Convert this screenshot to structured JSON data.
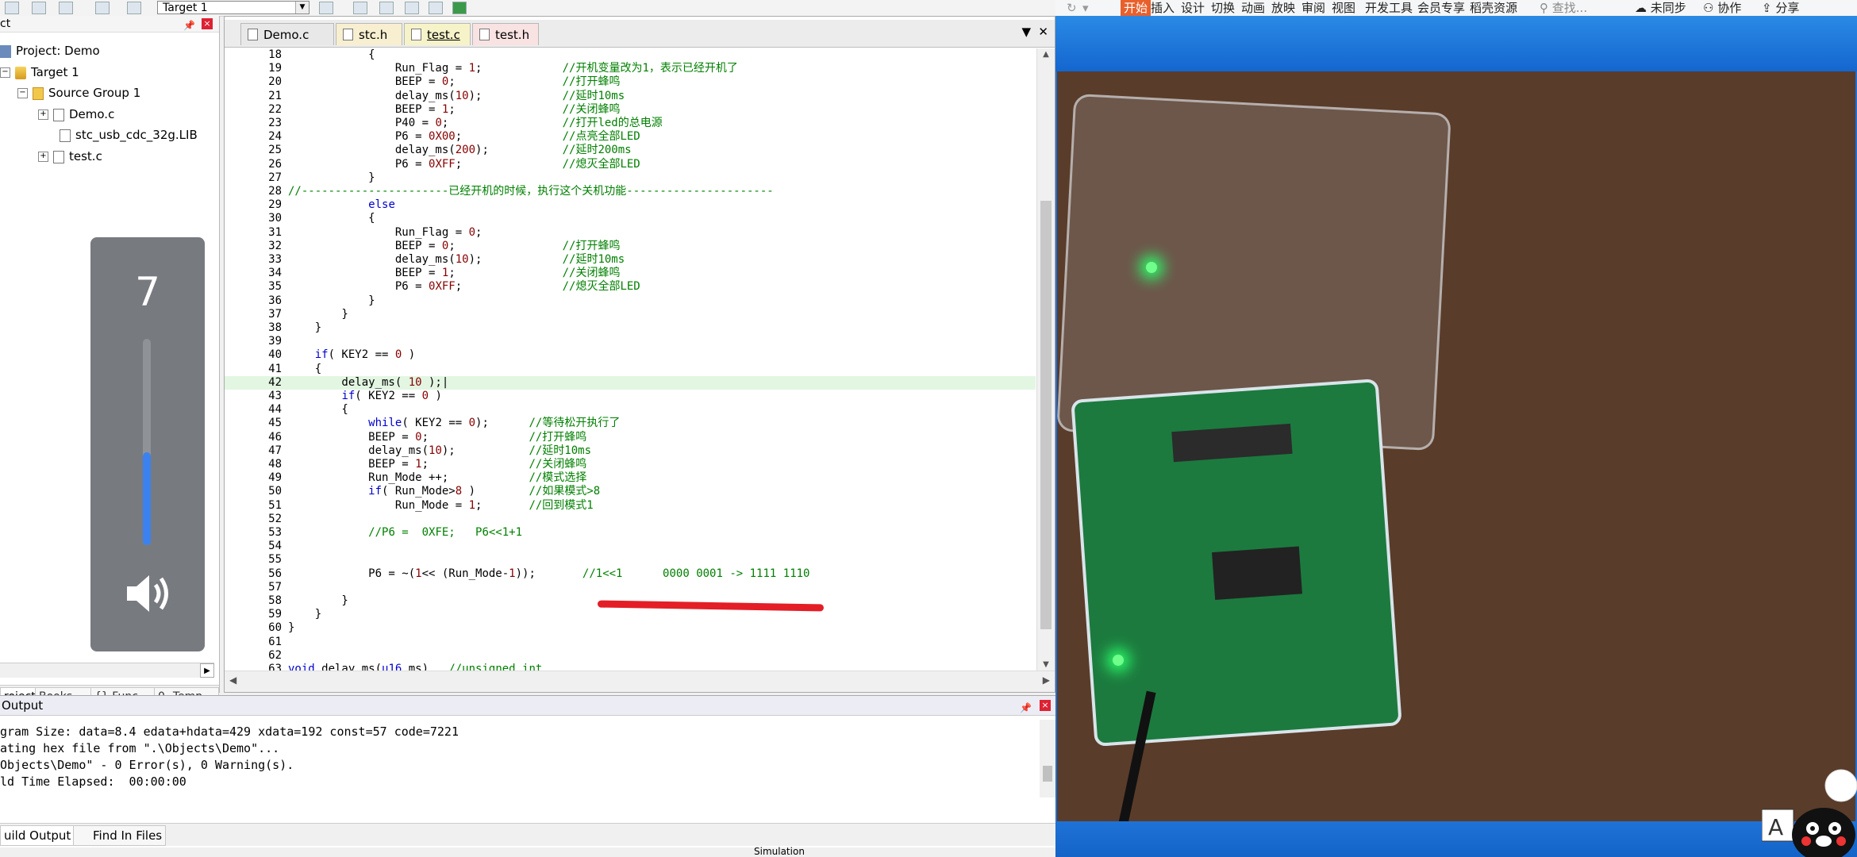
{
  "toolbar": {
    "target_select": "Target 1"
  },
  "project_panel": {
    "header": "ct",
    "tree": [
      {
        "label": "Project: Demo"
      },
      {
        "label": "Target 1"
      },
      {
        "label": "Source Group 1"
      },
      {
        "label": "Demo.c"
      },
      {
        "label": "stc_usb_cdc_32g.LIB"
      },
      {
        "label": "test.c"
      }
    ],
    "tabs": [
      "roject",
      "Books",
      "{} Func...",
      "0ₐ Temp..."
    ]
  },
  "volume_overlay": {
    "value": "7",
    "level": 0.45
  },
  "editor": {
    "tabs": [
      "Demo.c",
      "stc.h",
      "test.c",
      "test.h"
    ],
    "active_tab": "test.c",
    "highlighted_line": "42",
    "lines": [
      {
        "n": "18",
        "t": "            {"
      },
      {
        "n": "19",
        "t": "                Run_Flag = 1;            //开机变量改为1，表示已经开机了"
      },
      {
        "n": "20",
        "t": "                BEEP = 0;                //打开蜂鸣"
      },
      {
        "n": "21",
        "t": "                delay_ms(10);            //延时10ms"
      },
      {
        "n": "22",
        "t": "                BEEP = 1;                //关闭蜂鸣"
      },
      {
        "n": "23",
        "t": "                P40 = 0;                 //打开led的总电源"
      },
      {
        "n": "24",
        "t": "                P6 = 0X00;               //点亮全部LED"
      },
      {
        "n": "25",
        "t": "                delay_ms(200);           //延时200ms"
      },
      {
        "n": "26",
        "t": "                P6 = 0XFF;               //熄灭全部LED"
      },
      {
        "n": "27",
        "t": "            }"
      },
      {
        "n": "28",
        "t": "//----------------------已经开机的时候，执行这个关机功能----------------------"
      },
      {
        "n": "29",
        "t": "            else"
      },
      {
        "n": "30",
        "t": "            {"
      },
      {
        "n": "31",
        "t": "                Run_Flag = 0;"
      },
      {
        "n": "32",
        "t": "                BEEP = 0;                //打开蜂鸣"
      },
      {
        "n": "33",
        "t": "                delay_ms(10);            //延时10ms"
      },
      {
        "n": "34",
        "t": "                BEEP = 1;                //关闭蜂鸣"
      },
      {
        "n": "35",
        "t": "                P6 = 0XFF;               //熄灭全部LED"
      },
      {
        "n": "36",
        "t": "            }"
      },
      {
        "n": "37",
        "t": "        }"
      },
      {
        "n": "38",
        "t": "    }"
      },
      {
        "n": "39",
        "t": ""
      },
      {
        "n": "40",
        "t": "    if( KEY2 == 0 )"
      },
      {
        "n": "41",
        "t": "    {"
      },
      {
        "n": "42",
        "t": "        delay_ms( 10 );|"
      },
      {
        "n": "43",
        "t": "        if( KEY2 == 0 )"
      },
      {
        "n": "44",
        "t": "        {"
      },
      {
        "n": "45",
        "t": "            while( KEY2 == 0);      //等待松开执行了"
      },
      {
        "n": "46",
        "t": "            BEEP = 0;               //打开蜂鸣"
      },
      {
        "n": "47",
        "t": "            delay_ms(10);           //延时10ms"
      },
      {
        "n": "48",
        "t": "            BEEP = 1;               //关闭蜂鸣"
      },
      {
        "n": "49",
        "t": "            Run_Mode ++;            //模式选择"
      },
      {
        "n": "50",
        "t": "            if( Run_Mode>8 )        //如果模式>8"
      },
      {
        "n": "51",
        "t": "                Run_Mode = 1;       //回到模式1"
      },
      {
        "n": "52",
        "t": ""
      },
      {
        "n": "53",
        "t": "            //P6 =  0XFE;   P6<<1+1"
      },
      {
        "n": "54",
        "t": ""
      },
      {
        "n": "55",
        "t": ""
      },
      {
        "n": "56",
        "t": "            P6 = ~(1<< (Run_Mode-1));       //1<<1      0000 0001 -> 1111 1110"
      },
      {
        "n": "57",
        "t": ""
      },
      {
        "n": "58",
        "t": "        }"
      },
      {
        "n": "59",
        "t": "    }"
      },
      {
        "n": "60",
        "t": "}"
      },
      {
        "n": "61",
        "t": ""
      },
      {
        "n": "62",
        "t": ""
      },
      {
        "n": "63",
        "t": "void delay_ms(u16 ms)   //unsigned int"
      }
    ]
  },
  "build_output": {
    "title": "Output",
    "lines": [
      "gram Size: data=8.4 edata+hdata=429 xdata=192 const=57 code=7221",
      "ating hex file from \".\\Objects\\Demo\"...",
      "Objects\\Demo\" - 0 Error(s), 0 Warning(s).",
      "ld Time Elapsed:  00:00:00"
    ],
    "tabs": [
      "uild Output",
      "Find In Files"
    ]
  },
  "status_bar": {
    "text": "Simulation"
  },
  "wps_menu": {
    "start": "开始",
    "items": [
      "插入",
      "设计",
      "切换",
      "动画",
      "放映",
      "审阅",
      "视图",
      "开发工具",
      "会员专享",
      "稻壳资源"
    ],
    "search": "查找...",
    "sync": "未同步",
    "collab": "协作",
    "share": "分享"
  }
}
